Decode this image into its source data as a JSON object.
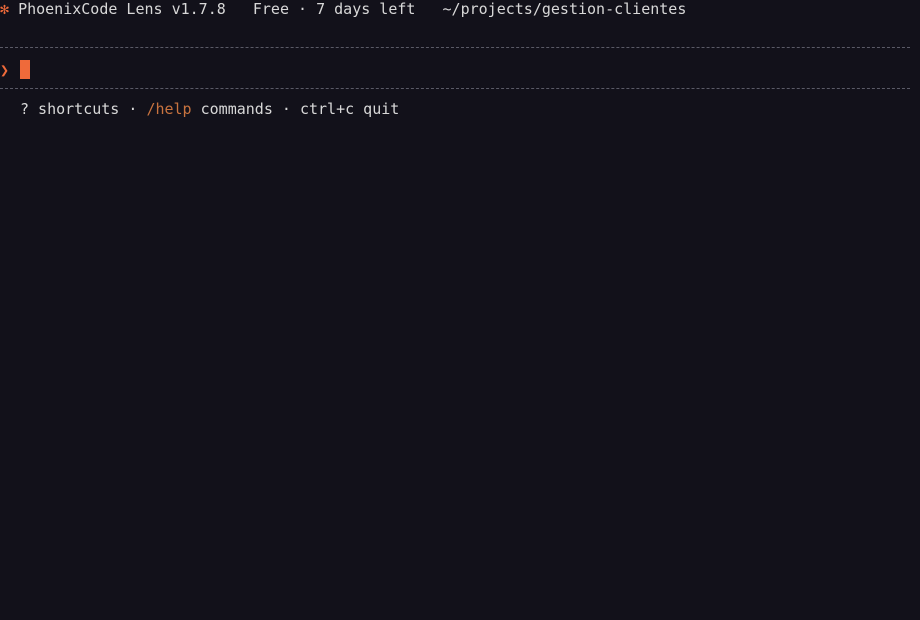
{
  "header": {
    "logo_glyph": "✻",
    "app_name": "PhoenixCode Lens v1.7.8",
    "plan": "Free · 7 days left",
    "cwd": "~/projects/gestion-clientes"
  },
  "prompt": {
    "caret": "❯",
    "value": ""
  },
  "hints": {
    "shortcuts": "? shortcuts · ",
    "help_command": "/help",
    "commands": " commands · ctrl+c quit"
  },
  "colors": {
    "background": "#12111a",
    "accent": "#ef6a3a",
    "help": "#c8733f",
    "text": "#d8d8d8"
  }
}
